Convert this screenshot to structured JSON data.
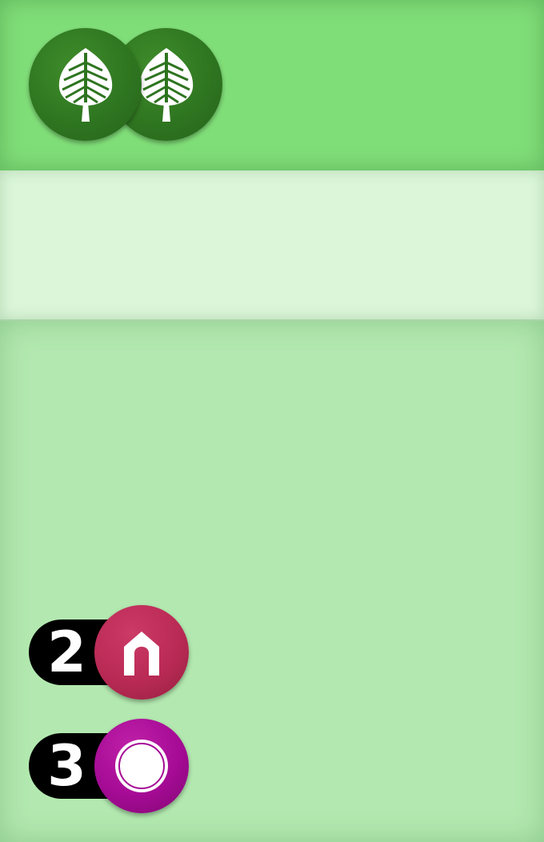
{
  "player_area": {
    "leaf_tokens": [
      {
        "icon": "leaf-icon"
      },
      {
        "icon": "leaf-icon"
      }
    ]
  },
  "resources": [
    {
      "count": "2",
      "icon": "house-icon",
      "color": "#b92a55"
    },
    {
      "count": "3",
      "icon": "circle-icon",
      "color": "#a50b95"
    }
  ],
  "colors": {
    "top_panel": "#80de78",
    "middle_panel": "#dcf6da",
    "bottom_panel": "#b3e9b0",
    "leaf_token": "#2e7420"
  }
}
